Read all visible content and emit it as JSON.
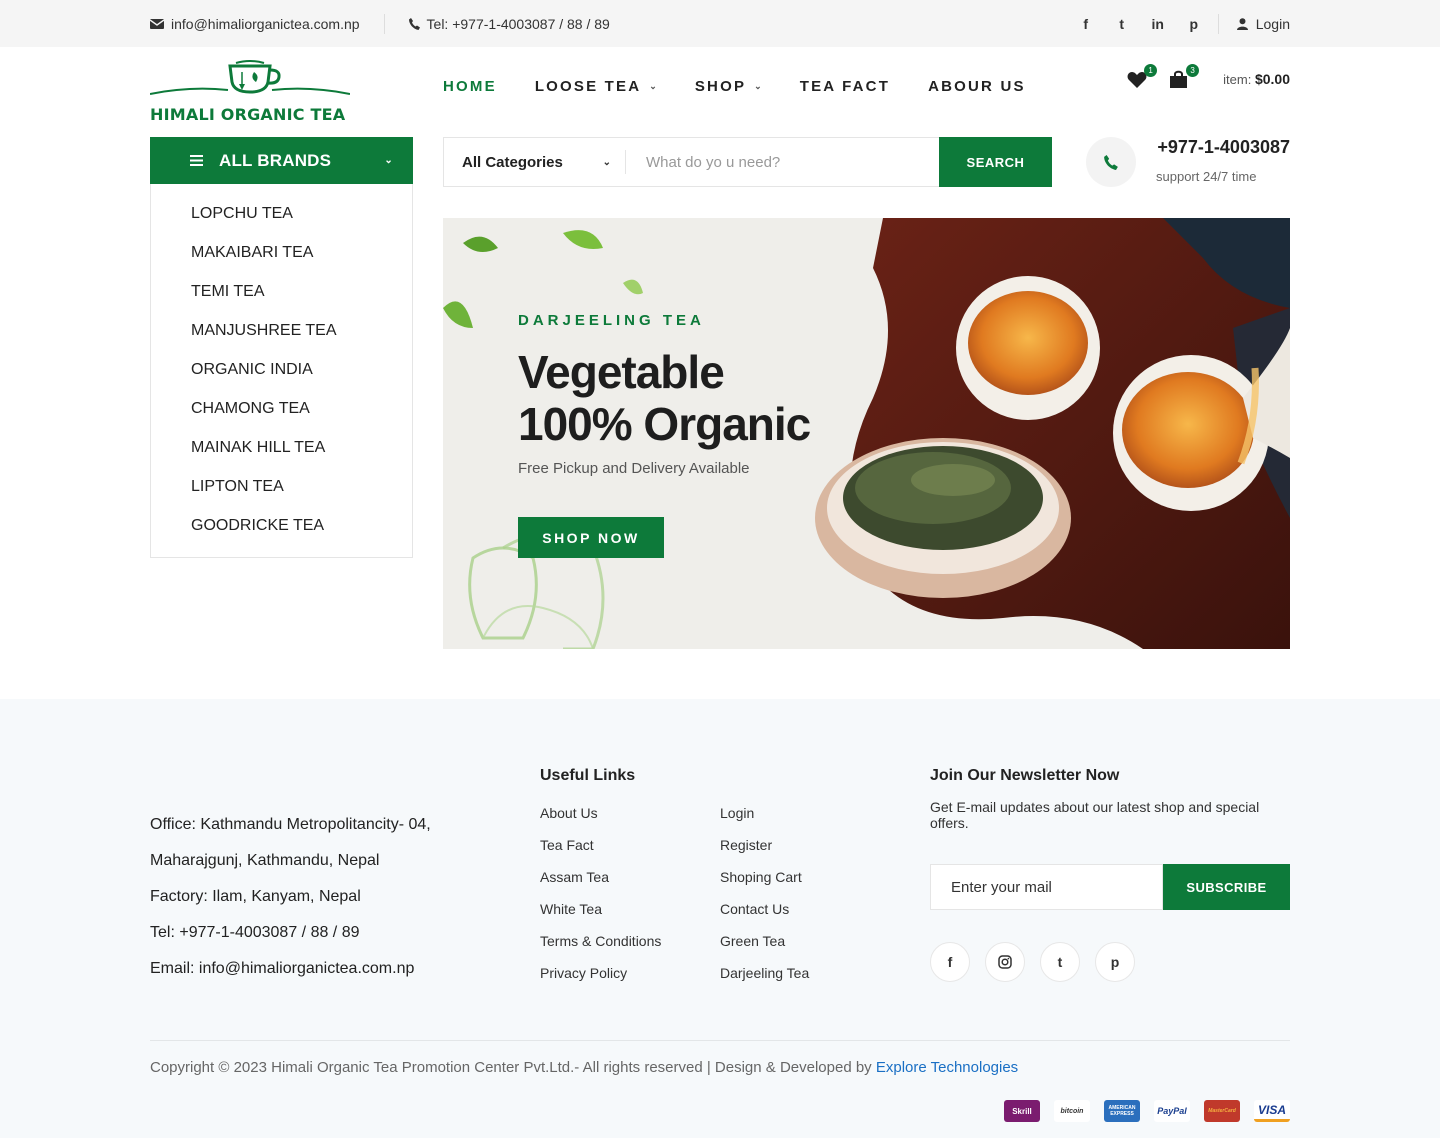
{
  "topbar": {
    "email": "info@himaliorganictea.com.np",
    "phone": "Tel: +977-1-4003087 / 88 / 89",
    "social": [
      "f",
      "t",
      "in",
      "p"
    ],
    "login": "Login"
  },
  "header": {
    "logo_text": "HIMALI ORGANIC TEA",
    "nav": [
      {
        "label": "HOME",
        "active": true,
        "dropdown": false
      },
      {
        "label": "LOOSE TEA",
        "active": false,
        "dropdown": true
      },
      {
        "label": "SHOP",
        "active": false,
        "dropdown": true
      },
      {
        "label": "TEA FACT",
        "active": false,
        "dropdown": false
      },
      {
        "label": "ABOUR US",
        "active": false,
        "dropdown": false
      }
    ],
    "wishlist_count": "1",
    "cart_count": "3",
    "cart_label": "item:",
    "cart_total": "$0.00"
  },
  "brands": {
    "title": "ALL BRANDS",
    "items": [
      "LOPCHU TEA",
      "MAKAIBARI TEA",
      "TEMI TEA",
      "MANJUSHREE TEA",
      "ORGANIC INDIA",
      "CHAMONG TEA",
      "MAINAK HILL TEA",
      "LIPTON TEA",
      "GOODRICKE TEA"
    ]
  },
  "search": {
    "category": "All Categories",
    "placeholder": "What do yo u need?",
    "button": "SEARCH"
  },
  "support": {
    "phone": "+977-1-4003087",
    "text": "support 24/7 time"
  },
  "hero": {
    "eyebrow": "DARJEELING TEA",
    "title_line1": "Vegetable",
    "title_line2": "100% Organic",
    "lead": "Free Pickup and Delivery Available",
    "button": "SHOP NOW"
  },
  "footer": {
    "address": [
      "Office: Kathmandu Metropolitancity- 04,",
      "Maharajgunj, Kathmandu, Nepal",
      "Factory: Ilam, Kanyam, Nepal",
      "Tel: +977-1-4003087 / 88 / 89",
      "Email: info@himaliorganictea.com.np"
    ],
    "links_title": "Useful Links",
    "links_col1": [
      "About Us",
      "Tea Fact",
      "Assam Tea",
      "White Tea",
      "Terms & Conditions",
      "Privacy Policy"
    ],
    "links_col2": [
      "Login",
      "Register",
      "Shoping Cart",
      "Contact Us",
      "Green Tea",
      "Darjeeling Tea"
    ],
    "newsletter_title": "Join Our Newsletter Now",
    "newsletter_text": "Get E-mail updates about our latest shop and special offers.",
    "newsletter_placeholder": "Enter your mail",
    "subscribe": "SUBSCRIBE",
    "copyright": "Copyright © 2023 Himali Organic Tea Promotion Center Pvt.Ltd.- All rights reserved | Design & Developed by",
    "developer": "Explore Technologies",
    "payments": [
      "Skrill",
      "bitcoin",
      "AMERICAN EXPRESS",
      "PayPal",
      "MasterCard",
      "VISA"
    ]
  },
  "colors": {
    "accent": "#0d7a3a",
    "link": "#1a6fc4"
  }
}
